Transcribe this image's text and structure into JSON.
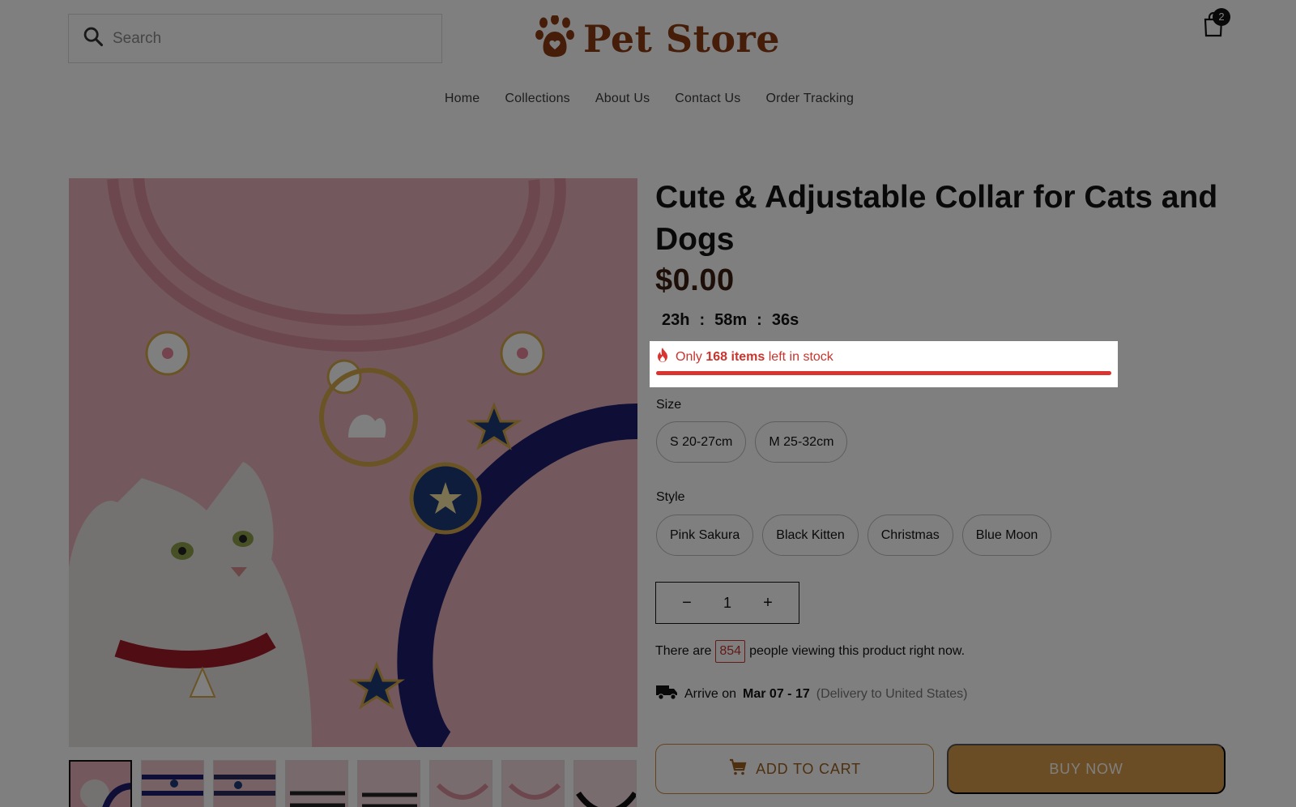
{
  "header": {
    "search_placeholder": "Search",
    "logo_text": "Pet Store",
    "cart_count": "2"
  },
  "nav": {
    "items": [
      "Home",
      "Collections",
      "About Us",
      "Contact Us",
      "Order Tracking"
    ]
  },
  "product": {
    "title": "Cute & Adjustable Collar for Cats and Dogs",
    "price": "$0.00",
    "countdown": {
      "hours": "23h",
      "sep1": ":",
      "minutes": "58m",
      "sep2": ":",
      "seconds": "36s"
    },
    "stock": {
      "prefix": "Only",
      "count_text": "168 items",
      "suffix": "left in stock",
      "level": 1.0
    },
    "size": {
      "label": "Size",
      "options": [
        "S 20-27cm",
        "M 25-32cm"
      ]
    },
    "style": {
      "label": "Style",
      "options": [
        "Pink Sakura",
        "Black Kitten",
        "Christmas",
        "Blue Moon"
      ]
    },
    "quantity": {
      "minus": "−",
      "value": "1",
      "plus": "+"
    },
    "viewers": {
      "prefix": "There are",
      "count": "854",
      "suffix": "people viewing this product right now."
    },
    "delivery": {
      "prefix": "Arrive on",
      "dates": "Mar 07 - 17",
      "note": "(Delivery to United States)"
    },
    "add_to_cart_label": "ADD TO CART",
    "buy_now_label": "BUY NOW"
  },
  "colors": {
    "brand": "#8a3b12",
    "accent": "#d69a4a",
    "stock_red": "#d9342f"
  },
  "icons": {
    "search": "search-icon",
    "logo": "paw-icon",
    "cart": "shopping-bag-icon",
    "stock": "fire-icon",
    "delivery": "truck-icon",
    "add_to_cart": "cart-icon"
  }
}
